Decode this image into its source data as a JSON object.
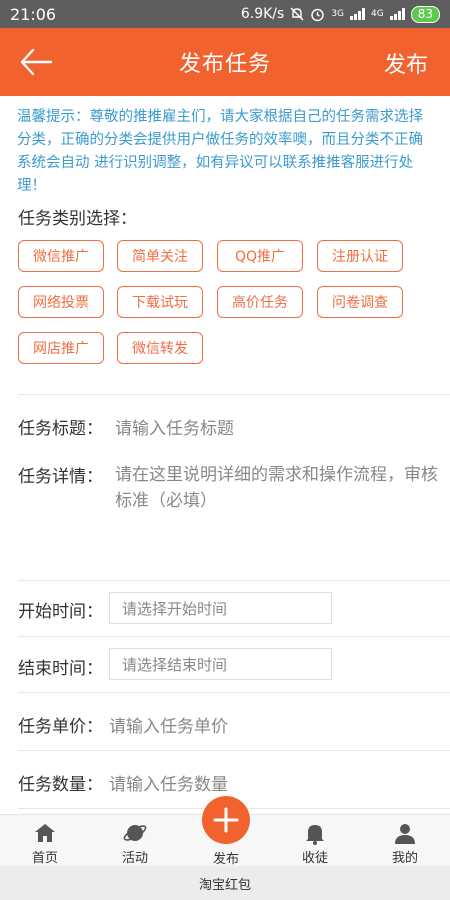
{
  "status_bar": {
    "time": "21:06",
    "net_speed": "6.9K/s",
    "signal_3g": "3G",
    "signal_4g": "4G",
    "battery": "83"
  },
  "header": {
    "title": "发布任务",
    "publish_label": "发布"
  },
  "tip": "温馨提示：尊敬的推推雇主们，请大家根据自己的任务需求选择分类，正确的分类会提供用户做任务的效率噢，而且分类不正确系统会自动 进行识别调整，如有异议可以联系推推客服进行处理！",
  "category": {
    "label": "任务类别选择：",
    "items": [
      "微信推广",
      "简单关注",
      "QQ推广",
      "注册认证",
      "网络投票",
      "下载试玩",
      "高价任务",
      "问卷调查",
      "网店推广",
      "微信转发"
    ]
  },
  "form": {
    "title_label": "任务标题：",
    "title_placeholder": "请输入任务标题",
    "detail_label": "任务详情：",
    "detail_placeholder": "请在这里说明详细的需求和操作流程，审核标准（必填）",
    "start_label": "开始时间：",
    "start_placeholder": "请选择开始时间",
    "end_label": "结束时间：",
    "end_placeholder": "请选择结束时间",
    "price_label": "任务单价：",
    "price_placeholder": "请输入任务单价",
    "count_label": "任务数量：",
    "count_placeholder": "请输入任务数量"
  },
  "tabbar": {
    "home": "首页",
    "activity": "活动",
    "publish": "发布",
    "apprentice": "收徒",
    "mine": "我的"
  },
  "system_bar": "淘宝红包",
  "colors": {
    "accent": "#f2622f",
    "tip_text": "#3b9bd0",
    "chip_border": "#ef6e43"
  }
}
